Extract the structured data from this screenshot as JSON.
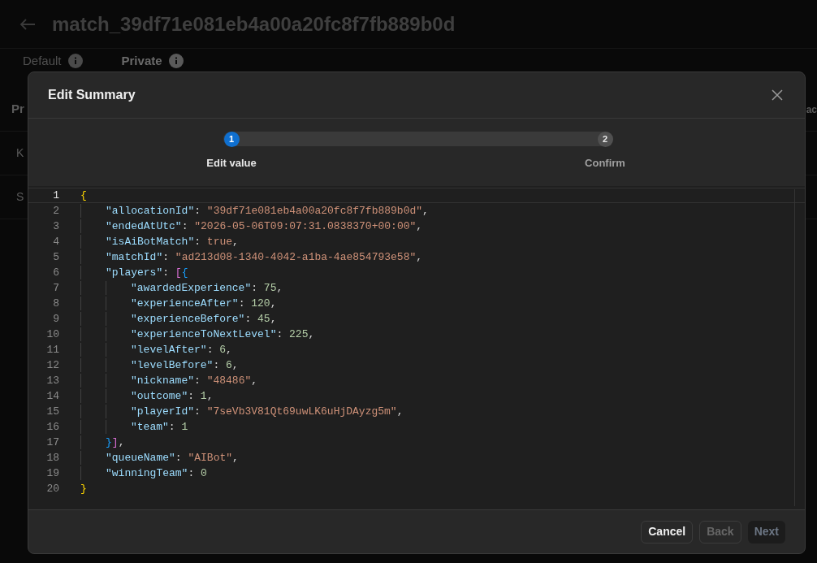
{
  "page": {
    "title": "match_39df71e081eb4a00a20fc8f7fb889b0d",
    "tabs": [
      {
        "label": "Default",
        "selected": false
      },
      {
        "label": "Private",
        "selected": true
      }
    ],
    "section_heading": "Pr",
    "section_heading_right": "ac",
    "rows": [
      "K",
      "S"
    ]
  },
  "dialog": {
    "title": "Edit Summary",
    "steps": [
      {
        "number": "1",
        "label": "Edit value",
        "selected": true
      },
      {
        "number": "2",
        "label": "Confirm",
        "selected": false
      }
    ],
    "editor": {
      "lines": [
        {
          "number": "1",
          "current": true,
          "tokens": [
            {
              "text": "{",
              "kind": "bracket1"
            }
          ]
        },
        {
          "number": "2",
          "current": false,
          "tokens": [
            {
              "text": "\"allocationId\"",
              "kind": "key"
            },
            {
              "text": ": ",
              "kind": "punct"
            },
            {
              "text": "\"39df71e081eb4a00a20fc8f7fb889b0d\"",
              "kind": "string"
            },
            {
              "text": ",",
              "kind": "punct"
            }
          ]
        },
        {
          "number": "3",
          "current": false,
          "tokens": [
            {
              "text": "\"endedAtUtc\"",
              "kind": "key"
            },
            {
              "text": ": ",
              "kind": "punct"
            },
            {
              "text": "\"2026-05-06T09:07:31.0838370+00:00\"",
              "kind": "string"
            },
            {
              "text": ",",
              "kind": "punct"
            }
          ]
        },
        {
          "number": "4",
          "current": false,
          "tokens": [
            {
              "text": "\"isAiBotMatch\"",
              "kind": "key"
            },
            {
              "text": ": ",
              "kind": "punct"
            },
            {
              "text": "true",
              "kind": "bool"
            },
            {
              "text": ",",
              "kind": "punct"
            }
          ]
        },
        {
          "number": "5",
          "current": false,
          "tokens": [
            {
              "text": "\"matchId\"",
              "kind": "key"
            },
            {
              "text": ": ",
              "kind": "punct"
            },
            {
              "text": "\"ad213d08-1340-4042-a1ba-4ae854793e58\"",
              "kind": "string"
            },
            {
              "text": ",",
              "kind": "punct"
            }
          ]
        },
        {
          "number": "6",
          "current": false,
          "tokens": [
            {
              "text": "\"players\"",
              "kind": "key"
            },
            {
              "text": ": ",
              "kind": "punct"
            },
            {
              "text": "[",
              "kind": "bracket2"
            },
            {
              "text": "{",
              "kind": "bracket3"
            }
          ]
        },
        {
          "number": "7",
          "current": false,
          "tokens": [
            {
              "text": "\"awardedExperience\"",
              "kind": "key"
            },
            {
              "text": ": ",
              "kind": "punct"
            },
            {
              "text": "75",
              "kind": "number"
            },
            {
              "text": ",",
              "kind": "punct"
            }
          ]
        },
        {
          "number": "8",
          "current": false,
          "tokens": [
            {
              "text": "\"experienceAfter\"",
              "kind": "key"
            },
            {
              "text": ": ",
              "kind": "punct"
            },
            {
              "text": "120",
              "kind": "number"
            },
            {
              "text": ",",
              "kind": "punct"
            }
          ]
        },
        {
          "number": "9",
          "current": false,
          "tokens": [
            {
              "text": "\"experienceBefore\"",
              "kind": "key"
            },
            {
              "text": ": ",
              "kind": "punct"
            },
            {
              "text": "45",
              "kind": "number"
            },
            {
              "text": ",",
              "kind": "punct"
            }
          ]
        },
        {
          "number": "10",
          "current": false,
          "tokens": [
            {
              "text": "\"experienceToNextLevel\"",
              "kind": "key"
            },
            {
              "text": ": ",
              "kind": "punct"
            },
            {
              "text": "225",
              "kind": "number"
            },
            {
              "text": ",",
              "kind": "punct"
            }
          ]
        },
        {
          "number": "11",
          "current": false,
          "tokens": [
            {
              "text": "\"levelAfter\"",
              "kind": "key"
            },
            {
              "text": ": ",
              "kind": "punct"
            },
            {
              "text": "6",
              "kind": "number"
            },
            {
              "text": ",",
              "kind": "punct"
            }
          ]
        },
        {
          "number": "12",
          "current": false,
          "tokens": [
            {
              "text": "\"levelBefore\"",
              "kind": "key"
            },
            {
              "text": ": ",
              "kind": "punct"
            },
            {
              "text": "6",
              "kind": "number"
            },
            {
              "text": ",",
              "kind": "punct"
            }
          ]
        },
        {
          "number": "13",
          "current": false,
          "tokens": [
            {
              "text": "\"nickname\"",
              "kind": "key"
            },
            {
              "text": ": ",
              "kind": "punct"
            },
            {
              "text": "\"48486\"",
              "kind": "string"
            },
            {
              "text": ",",
              "kind": "punct"
            }
          ]
        },
        {
          "number": "14",
          "current": false,
          "tokens": [
            {
              "text": "\"outcome\"",
              "kind": "key"
            },
            {
              "text": ": ",
              "kind": "punct"
            },
            {
              "text": "1",
              "kind": "number"
            },
            {
              "text": ",",
              "kind": "punct"
            }
          ]
        },
        {
          "number": "15",
          "current": false,
          "tokens": [
            {
              "text": "\"playerId\"",
              "kind": "key"
            },
            {
              "text": ": ",
              "kind": "punct"
            },
            {
              "text": "\"7seVb3V81Qt69uwLK6uHjDAyzg5m\"",
              "kind": "string"
            },
            {
              "text": ",",
              "kind": "punct"
            }
          ]
        },
        {
          "number": "16",
          "current": false,
          "tokens": [
            {
              "text": "\"team\"",
              "kind": "key"
            },
            {
              "text": ": ",
              "kind": "punct"
            },
            {
              "text": "1",
              "kind": "number"
            }
          ]
        },
        {
          "number": "17",
          "current": false,
          "tokens": [
            {
              "text": "}",
              "kind": "bracket3"
            },
            {
              "text": "]",
              "kind": "bracket2"
            },
            {
              "text": ",",
              "kind": "punct"
            }
          ]
        },
        {
          "number": "18",
          "current": false,
          "tokens": [
            {
              "text": "\"queueName\"",
              "kind": "key"
            },
            {
              "text": ": ",
              "kind": "punct"
            },
            {
              "text": "\"AIBot\"",
              "kind": "string"
            },
            {
              "text": ",",
              "kind": "punct"
            }
          ]
        },
        {
          "number": "19",
          "current": false,
          "tokens": [
            {
              "text": "\"winningTeam\"",
              "kind": "key"
            },
            {
              "text": ": ",
              "kind": "punct"
            },
            {
              "text": "0",
              "kind": "number"
            }
          ]
        },
        {
          "number": "20",
          "current": false,
          "tokens": [
            {
              "text": "}",
              "kind": "bracket1"
            }
          ]
        }
      ]
    },
    "buttons": [
      {
        "label": "Cancel",
        "disabled": false,
        "kind": "outline"
      },
      {
        "label": "Back",
        "disabled": true,
        "kind": "outline"
      },
      {
        "label": "Next",
        "disabled": true,
        "kind": "solid"
      }
    ]
  }
}
